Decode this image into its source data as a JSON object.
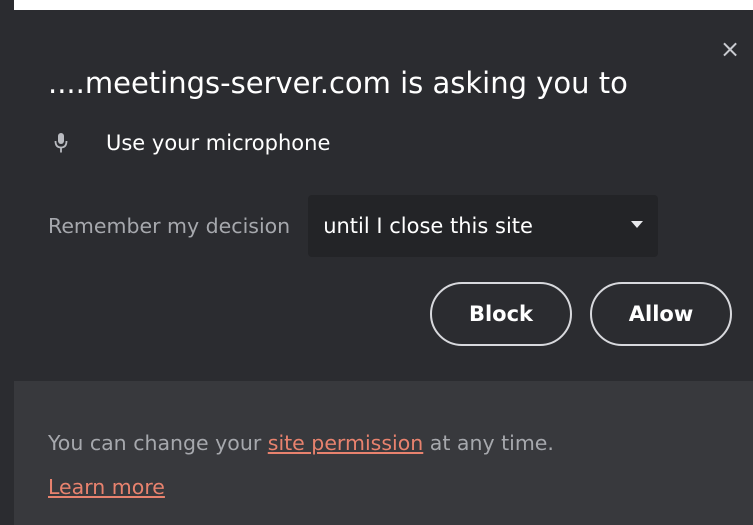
{
  "prompt": {
    "title": "....meetings-server.com is asking you to",
    "permission": {
      "icon": "microphone-icon",
      "label": "Use your microphone"
    },
    "remember": {
      "label": "Remember my decision",
      "selected_option": "until I close this site"
    },
    "buttons": {
      "block_label": "Block",
      "allow_label": "Allow"
    },
    "close_glyph": "×",
    "footer": {
      "prefix": "You can change your ",
      "permission_link": "site permission",
      "suffix": " at any time.",
      "learn_more": "Learn more"
    }
  },
  "colors": {
    "popup_background": "#2b2c30",
    "footer_background": "#38393d",
    "select_background": "#232427",
    "link_color": "#e8826e",
    "secondary_text": "#a6a8ad"
  }
}
